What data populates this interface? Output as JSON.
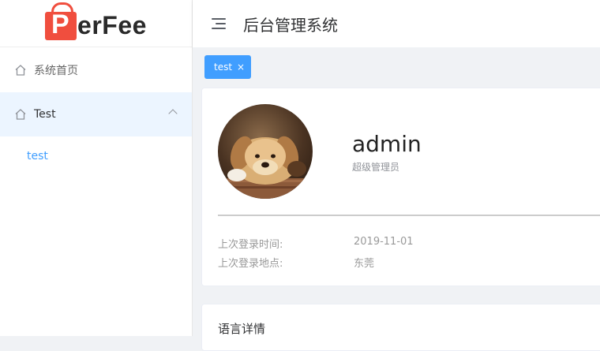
{
  "brand": {
    "logo_letter": "P",
    "logo_rest": "erFee"
  },
  "sidebar": {
    "items": [
      {
        "label": "系统首页",
        "icon": "home-icon"
      },
      {
        "label": "Test",
        "icon": "home-icon",
        "expanded": true,
        "children": [
          {
            "label": "test"
          }
        ]
      }
    ]
  },
  "header": {
    "title": "后台管理系统",
    "menu_icon": "hamburger-icon"
  },
  "tags": [
    {
      "label": "test",
      "close": "×",
      "active": true
    }
  ],
  "profile": {
    "name": "admin",
    "role": "超级管理员",
    "last_login_time_label": "上次登录时间:",
    "last_login_time": "2019-11-01",
    "last_login_place_label": "上次登录地点:",
    "last_login_place": "东莞"
  },
  "language_card": {
    "title": "语言详情"
  },
  "colors": {
    "accent": "#409eff",
    "logo": "#f04e3e",
    "active_bg": "#ecf5ff"
  }
}
